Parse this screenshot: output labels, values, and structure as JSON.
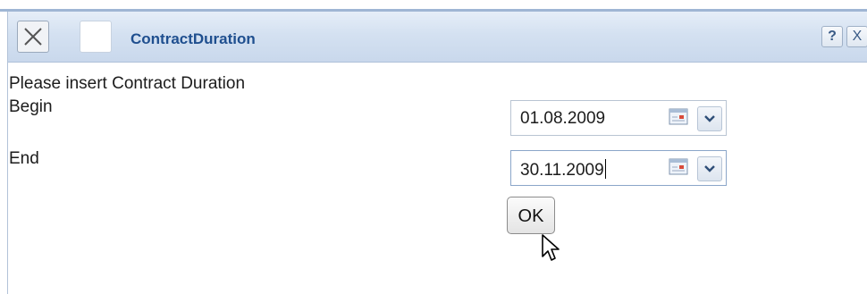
{
  "dialog": {
    "title": "ContractDuration",
    "help_label": "?",
    "close_label": "X"
  },
  "form": {
    "instruction": "Please insert Contract Duration",
    "begin_label": "Begin",
    "begin_value": "01.08.2009",
    "end_label": "End",
    "end_value": "30.11.2009",
    "ok_label": "OK"
  },
  "icons": {
    "close_big": "close-icon",
    "calendar": "calendar-icon",
    "dropdown": "chevron-down-icon",
    "cursor": "mouse-pointer-icon"
  },
  "colors": {
    "title_text": "#1f4f8f",
    "titlebar": "#d4e1f1",
    "focus_border": "#8ba6c9"
  }
}
